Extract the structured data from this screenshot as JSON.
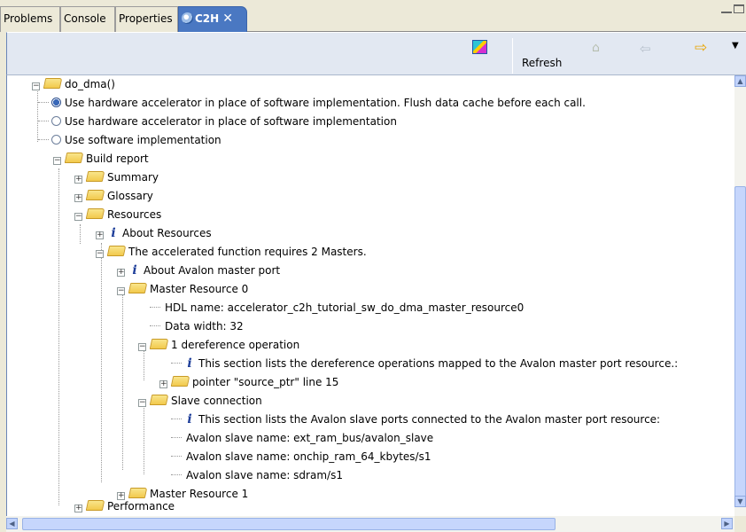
{
  "tabs": [
    {
      "label": "Problems",
      "active": false
    },
    {
      "label": "Console",
      "active": false
    },
    {
      "label": "Properties",
      "active": false
    },
    {
      "label": "C2H",
      "active": true
    }
  ],
  "tab_close_glyph": "✕",
  "toolbar": {
    "refresh_label": "Refresh",
    "icons": [
      "c2h-icon",
      "home-icon",
      "back-arrow-icon",
      "forward-arrow-icon",
      "view-menu-icon"
    ]
  },
  "tree": {
    "do_dma": "do_dma()",
    "opt_hw_flush": "Use hardware accelerator in place of software implementation. Flush data cache before each call.",
    "opt_hw": "Use hardware accelerator in place of software implementation",
    "opt_sw": "Use software implementation",
    "build_report": "Build report",
    "summary": "Summary",
    "glossary": "Glossary",
    "resources": "Resources",
    "about_resources": "About Resources",
    "masters_required": "The accelerated function requires 2 Masters.",
    "about_avalon_master": "About Avalon master port",
    "master_resource_0": "Master Resource 0",
    "hdl_name": "HDL name: accelerator_c2h_tutorial_sw_do_dma_master_resource0",
    "data_width": "Data width: 32",
    "deref_op": "1 dereference operation",
    "deref_info": "This section lists the dereference operations mapped to the Avalon master port resource.:",
    "pointer_source": "pointer \"source_ptr\" line 15",
    "slave_connection": "Slave connection",
    "slave_info": "This section lists the Avalon slave ports connected to the Avalon master port resource:",
    "slave_1": "Avalon slave name: ext_ram_bus/avalon_slave",
    "slave_2": "Avalon slave name: onchip_ram_64_kbytes/s1",
    "slave_3": "Avalon slave name: sdram/s1",
    "master_resource_1": "Master Resource 1",
    "performance": "Performance"
  },
  "colors": {
    "active_tab": "#4a78c2",
    "toolbar_bg": "#e2e8f2",
    "folder": "#f2c94c",
    "info_icon": "#1f3f9a"
  }
}
